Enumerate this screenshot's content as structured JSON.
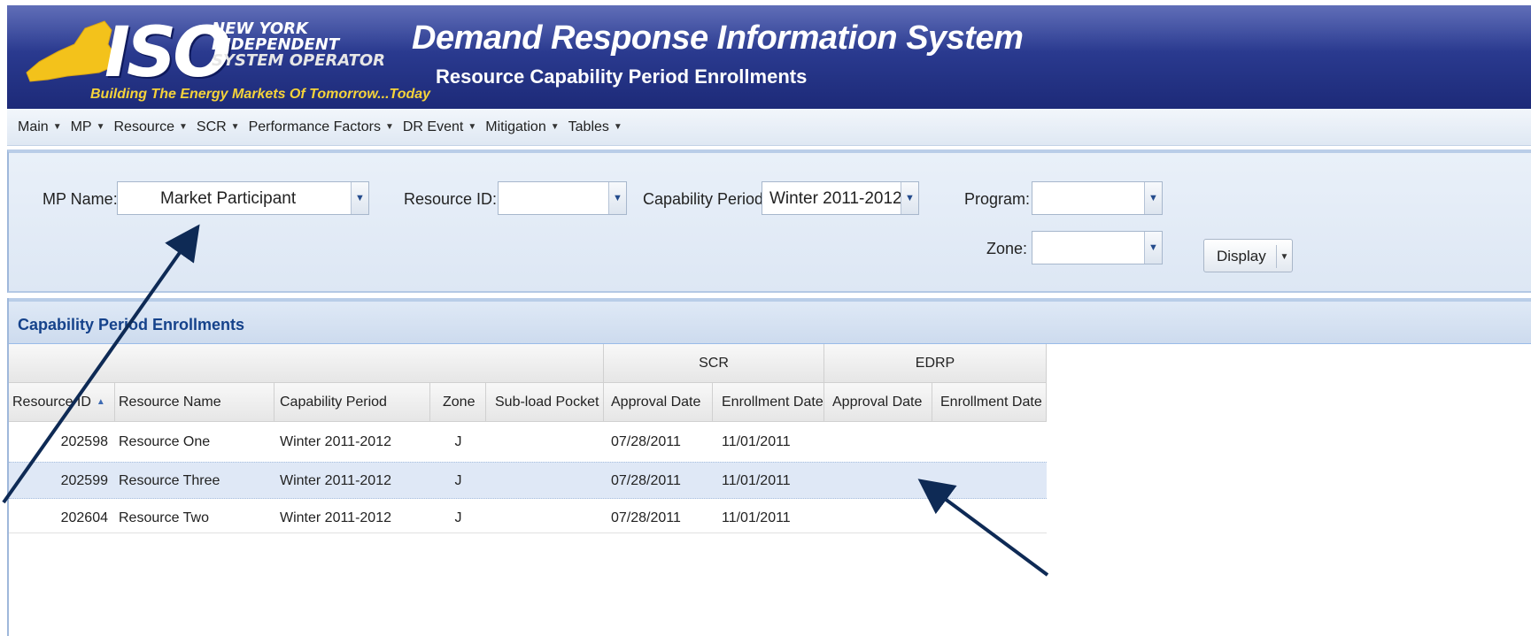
{
  "header": {
    "logo_letters": "ISO",
    "org_line1": "NEW YORK",
    "org_line2": "INDEPENDENT",
    "org_line3": "SYSTEM OPERATOR",
    "tagline": "Building The Energy Markets Of Tomorrow...Today",
    "app_title": "Demand Response Information System",
    "page_subtitle": "Resource Capability Period Enrollments"
  },
  "menu": {
    "items": [
      {
        "label": "Main"
      },
      {
        "label": "MP"
      },
      {
        "label": "Resource"
      },
      {
        "label": "SCR"
      },
      {
        "label": "Performance Factors"
      },
      {
        "label": "DR Event"
      },
      {
        "label": "Mitigation"
      },
      {
        "label": "Tables"
      }
    ]
  },
  "filters": {
    "mp_name_label": "MP Name:",
    "mp_name_value": "Market Participant",
    "resource_id_label": "Resource ID:",
    "resource_id_value": "",
    "capability_period_label": "Capability Period:",
    "capability_period_value": "Winter 2011-2012",
    "program_label": "Program:",
    "program_value": "",
    "zone_label": "Zone:",
    "zone_value": "",
    "display_button": "Display"
  },
  "grid": {
    "title": "Capability Period Enrollments",
    "groups": {
      "scr": "SCR",
      "edrp": "EDRP"
    },
    "columns": {
      "resource_id": "Resource ID",
      "resource_name": "Resource Name",
      "capability_period": "Capability Period",
      "zone": "Zone",
      "sub_load_pocket": "Sub-load Pocket",
      "scr_approval": "Approval Date",
      "scr_enrollment": "Enrollment Date",
      "edrp_approval": "Approval Date",
      "edrp_enrollment": "Enrollment Date"
    },
    "rows": [
      {
        "resource_id": "202598",
        "resource_name": "Resource One",
        "capability_period": "Winter 2011-2012",
        "zone": "J",
        "sub_load_pocket": "",
        "scr_approval": "07/28/2011",
        "scr_enrollment": "11/01/2011",
        "edrp_approval": "",
        "edrp_enrollment": ""
      },
      {
        "resource_id": "202599",
        "resource_name": "Resource Three",
        "capability_period": "Winter 2011-2012",
        "zone": "J",
        "sub_load_pocket": "",
        "scr_approval": "07/28/2011",
        "scr_enrollment": "11/01/2011",
        "edrp_approval": "",
        "edrp_enrollment": ""
      },
      {
        "resource_id": "202604",
        "resource_name": "Resource Two",
        "capability_period": "Winter 2011-2012",
        "zone": "J",
        "sub_load_pocket": "",
        "scr_approval": "07/28/2011",
        "scr_enrollment": "11/01/2011",
        "edrp_approval": "",
        "edrp_enrollment": ""
      }
    ]
  },
  "colors": {
    "banner": "#2a3a8f",
    "tagline": "#f5d33a",
    "grid_title": "#15428b",
    "selected_row": "#dfe8f6",
    "annotation_arrow": "#0e2a55"
  }
}
